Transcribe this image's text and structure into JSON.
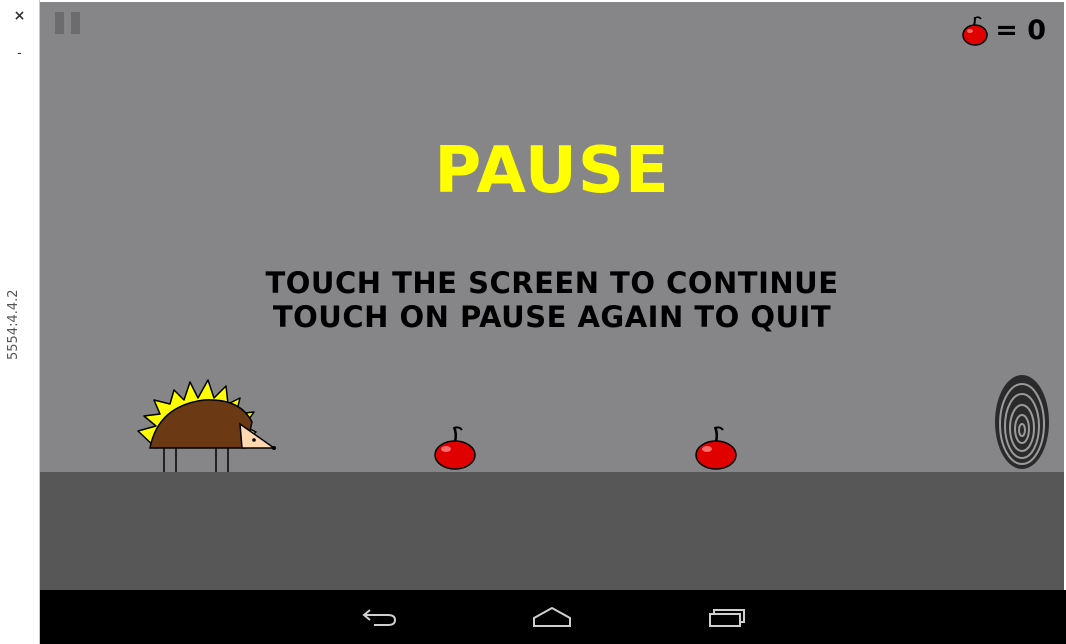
{
  "emulator": {
    "close_glyph": "×",
    "minimize_glyph": "-",
    "device_label": "5554:4.4.2"
  },
  "hud": {
    "pause_icon": "pause-icon",
    "score_icon": "cherry-icon",
    "score_label": "= 0"
  },
  "overlay": {
    "title": "PAUSE",
    "line1": "TOUCH THE SCREEN TO CONTINUE",
    "line2": "TOUCH ON PAUSE AGAIN TO QUIT"
  },
  "scene": {
    "player": "hedgehog",
    "collectibles": [
      "cherry",
      "cherry"
    ],
    "obstacle": "fingerprint"
  },
  "navbar": {
    "buttons": [
      "back-icon",
      "home-icon",
      "recent-apps-icon"
    ]
  },
  "colors": {
    "sky": "#868587",
    "ground": "#575757",
    "title": "#ffff00",
    "cherry": "#e00000",
    "hedgehog_body": "#6b3a14",
    "spikes": "#ffff00",
    "navbar": "#000000"
  }
}
